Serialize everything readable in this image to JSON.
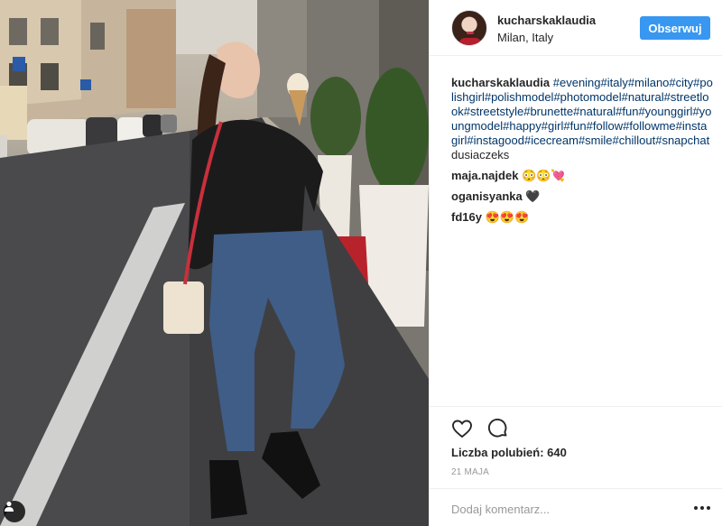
{
  "post": {
    "username": "kucharskaklaudia",
    "location": "Milan, Italy",
    "follow_label": "Obserwuj",
    "caption": {
      "username": "kucharskaklaudia",
      "hashtags": [
        "#evening",
        "#italy",
        "#milano",
        "#city",
        "#polishgirl",
        "#polishmodel",
        "#photomodel",
        "#natural",
        "#streetlook",
        "#streetstyle",
        "#brunette",
        "#natural",
        "#fun",
        "#younggirl",
        "#youngmodel",
        "#happy",
        "#girl",
        "#fun",
        "#follow",
        "#followme",
        "#instagirl",
        "#instagood",
        "#icecream",
        "#smile",
        "#chillout",
        "#snapchat"
      ],
      "trailing_text": " dusiaczeks"
    },
    "comments": [
      {
        "username": "maja.najdek",
        "text": "😳😳💘"
      },
      {
        "username": "oganisyanka",
        "text": "🖤"
      },
      {
        "username": "fd16y",
        "text": "😍😍😍"
      }
    ],
    "likes_text": "Liczba polubień: 640",
    "date_text": "21 MAJA",
    "add_comment_placeholder": "Dodaj komentarz...",
    "icons": {
      "like": "heart-icon",
      "comment": "comment-bubble-icon",
      "more": "more-options-icon",
      "user_tag": "person-tag-icon"
    },
    "colors": {
      "follow_button": "#3897f0",
      "hashtag": "#003569",
      "muted": "#999999",
      "border": "#efefef"
    }
  }
}
